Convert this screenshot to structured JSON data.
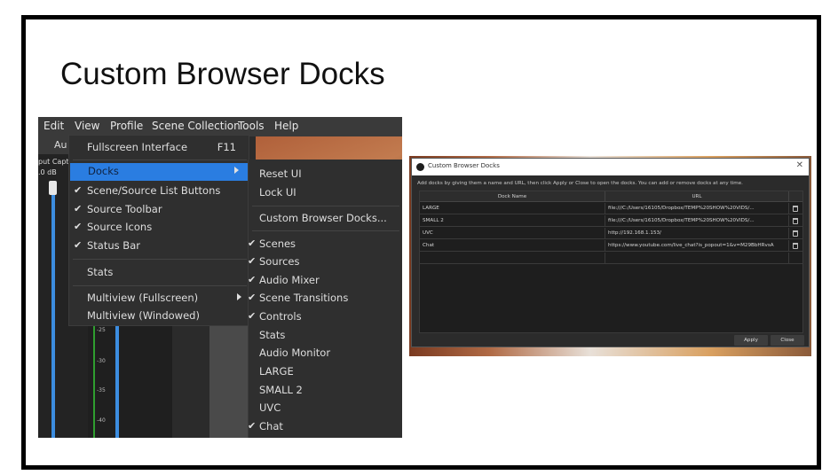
{
  "slide": {
    "title": "Custom Browser Docks"
  },
  "obs_window": {
    "menubar": [
      "Edit",
      "View",
      "Profile",
      "Scene Collection",
      "Tools",
      "Help"
    ],
    "audio_tab_label": "Au",
    "input_capture_label": "put Capt",
    "volume_db_label": ".0 dB",
    "meter_ticks": [
      "-25",
      "-30",
      "-35",
      "-40"
    ],
    "view_menu": {
      "items": [
        {
          "label": "Fullscreen Interface",
          "shortcut": "F11",
          "checked": false
        },
        {
          "label": "Docks",
          "submenu": true,
          "highlighted": true,
          "checked": false
        },
        {
          "label": "Scene/Source List Buttons",
          "checked": true
        },
        {
          "label": "Source Toolbar",
          "checked": true
        },
        {
          "label": "Source Icons",
          "checked": true
        },
        {
          "label": "Status Bar",
          "checked": true
        },
        {
          "label": "Stats",
          "checked": false
        },
        {
          "label": "Multiview (Fullscreen)",
          "submenu": true,
          "checked": false
        },
        {
          "label": "Multiview (Windowed)",
          "checked": false
        }
      ]
    },
    "docks_submenu": {
      "items": [
        {
          "label": "Reset UI",
          "checked": false
        },
        {
          "label": "Lock UI",
          "checked": false
        },
        {
          "label": "Custom Browser Docks...",
          "checked": false
        },
        {
          "label": "Scenes",
          "checked": true
        },
        {
          "label": "Sources",
          "checked": true
        },
        {
          "label": "Audio Mixer",
          "checked": true
        },
        {
          "label": "Scene Transitions",
          "checked": true
        },
        {
          "label": "Controls",
          "checked": true
        },
        {
          "label": "Stats",
          "checked": false
        },
        {
          "label": "Audio Monitor",
          "checked": false
        },
        {
          "label": "LARGE",
          "checked": false
        },
        {
          "label": "SMALL 2",
          "checked": false
        },
        {
          "label": "UVC",
          "checked": false
        },
        {
          "label": "Chat",
          "checked": true
        }
      ]
    },
    "check_glyph": "✔",
    "colors": {
      "highlight": "#2a7de1",
      "meter": "#3c8de0",
      "meter_green": "#2f9e2f"
    }
  },
  "dialog": {
    "title": "Custom Browser Docks",
    "close_glyph": "✕",
    "description": "Add docks by giving them a name and URL, then click Apply or Close to open the docks. You can add or remove docks at any time.",
    "columns": [
      "Dock Name",
      "URL"
    ],
    "rows": [
      {
        "name": "LARGE",
        "url": "file:///C:/Users/16105/Dropbox/TEMP%20SHOW%20VIDS/..."
      },
      {
        "name": "SMALL 2",
        "url": "file:///C:/Users/16105/Dropbox/TEMP%20SHOW%20VIDS/..."
      },
      {
        "name": "UVC",
        "url": "http://192.168.1.153/"
      },
      {
        "name": "Chat",
        "url": "https://www.youtube.com/live_chat?is_popout=1&v=M29BbHRvsA"
      }
    ],
    "apply_label": "Apply",
    "close_label": "Close"
  }
}
